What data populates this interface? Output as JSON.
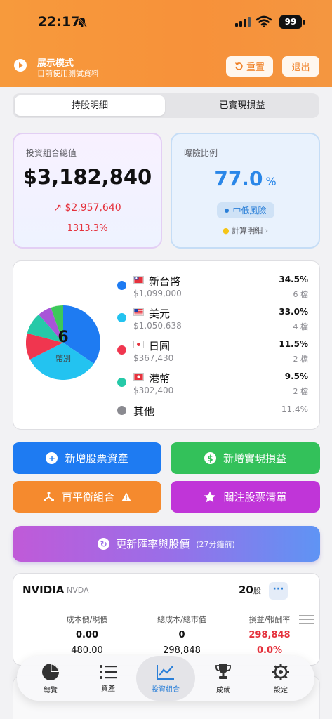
{
  "status_bar": {
    "time": "22:17",
    "battery": "99"
  },
  "demo": {
    "title": "展示模式",
    "subtitle": "目前使用測試資料",
    "reset_label": "重置",
    "exit_label": "退出"
  },
  "segment": {
    "tabs": [
      "持股明細",
      "已實現損益"
    ],
    "active": 0
  },
  "portfolio": {
    "label": "投資組合總值",
    "total": "$3,182,840",
    "gain": "$2,957,640",
    "gain_pct": "1313.3%"
  },
  "risk": {
    "label": "曝險比例",
    "value": "77.0",
    "unit": "%",
    "badge": "中低風險",
    "detail": "計算明細"
  },
  "allocation": {
    "count": "6",
    "unit": "幣別",
    "items": [
      {
        "name": "新台幣",
        "amount": "$1,099,000",
        "pct": "34.5%",
        "count": "6 檔",
        "color": "#1e7bf2"
      },
      {
        "name": "美元",
        "amount": "$1,050,638",
        "pct": "33.0%",
        "count": "4 檔",
        "color": "#23c3f0"
      },
      {
        "name": "日圓",
        "amount": "$367,430",
        "pct": "11.5%",
        "count": "2 檔",
        "color": "#f0364f"
      },
      {
        "name": "港幣",
        "amount": "$302,400",
        "pct": "9.5%",
        "count": "2 檔",
        "color": "#26c9a8"
      },
      {
        "name": "其他",
        "pct": "11.4%",
        "color": "#8a8a90"
      }
    ]
  },
  "chart_data": {
    "type": "pie",
    "categories": [
      "新台幣",
      "美元",
      "日圓",
      "港幣",
      "其他"
    ],
    "values": [
      34.5,
      33.0,
      11.5,
      9.5,
      11.4
    ],
    "other_breakdown": [
      {
        "color": "#a855d8",
        "value": 6.0
      },
      {
        "color": "#3cc85a",
        "value": 5.4
      }
    ]
  },
  "actions": {
    "add_stock": "新增股票資產",
    "add_realized": "新增實現損益",
    "rebalance": "再平衡組合",
    "watchlist": "關注股票清單"
  },
  "update": {
    "label": "更新匯率與股價",
    "ago": "(27分鐘前)"
  },
  "stock": {
    "name": "NVIDIA",
    "ticker": "NVDA",
    "shares": "20",
    "shares_unit": "股",
    "headers": [
      "成本價/現價",
      "總成本/總市值",
      "損益/報酬率"
    ],
    "cost_price": "0.00",
    "current_price": "480.00",
    "total_cost": "0",
    "market_value": "298,848",
    "pnl": "298,848",
    "return_rate": "0.0%"
  },
  "tabbar": {
    "items": [
      "總覽",
      "資產",
      "投資組合",
      "成就",
      "設定"
    ],
    "active": 2
  }
}
